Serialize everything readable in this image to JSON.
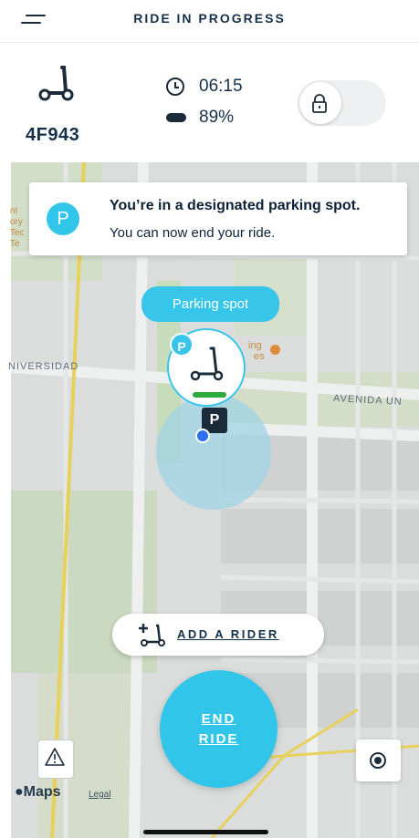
{
  "header": {
    "title": "RIDE IN PROGRESS",
    "menu_icon": "menu-icon"
  },
  "status": {
    "vehicle_id": "4F943",
    "time": "06:15",
    "battery": "89%",
    "lock_state": "locked"
  },
  "notice": {
    "badge": "P",
    "title": "You’re in a designated parking spot.",
    "subtitle": "You can now end your ride."
  },
  "map": {
    "parking_spot_label": "Parking spot",
    "marker_badge": "P",
    "marker_sign": "P",
    "street_labels": [
      "NIVERSIDAD",
      "AVENIDA UN",
      "ing",
      "es"
    ],
    "left_edge_labels": [
      "nt",
      "ory",
      "Tec",
      "Te"
    ],
    "maps_brand": "Maps",
    "legal_label": "Legal"
  },
  "actions": {
    "add_rider_label": "ADD A RIDER",
    "end_ride_line1": "END",
    "end_ride_line2": "RIDE"
  },
  "colors": {
    "accent": "#31c5ea",
    "dark": "#15304a",
    "battery_bar": "#2daa3c",
    "location_dot": "#2d6ff0"
  }
}
